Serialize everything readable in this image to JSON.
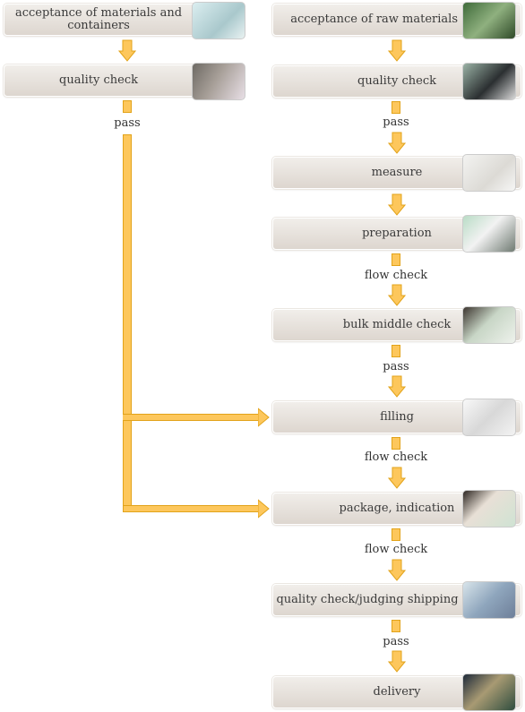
{
  "colors": {
    "arrow_fill": "#fdc75c",
    "arrow_border": "#e2a31a",
    "box_top": "#f1eeea",
    "box_bottom": "#ddd6cf"
  },
  "left_column": {
    "steps": [
      {
        "label": "acceptance of materials and containers",
        "image": "bottles-photo"
      },
      {
        "label": "quality check",
        "image": "worker-photo"
      }
    ],
    "connector_label": "pass"
  },
  "right_column": {
    "steps": [
      {
        "label": "acceptance of raw materials",
        "image": "plants-photo"
      },
      {
        "label": "quality check",
        "image": "microscope-photo"
      },
      {
        "label": "measure",
        "image": "flasks-photo"
      },
      {
        "label": "preparation",
        "image": "lab-workers-photo"
      },
      {
        "label": "bulk middle check",
        "image": "researcher-photo"
      },
      {
        "label": "filling",
        "image": "containers-photo"
      },
      {
        "label": "package, indication",
        "image": "lab-woman-photo"
      },
      {
        "label": "quality check/judging shipping",
        "image": "inspection-photo"
      },
      {
        "label": "delivery",
        "image": "warehouse-photo"
      }
    ],
    "connector_labels": [
      "pass",
      "flow check",
      "pass",
      "flow check",
      "flow check",
      "pass"
    ]
  }
}
